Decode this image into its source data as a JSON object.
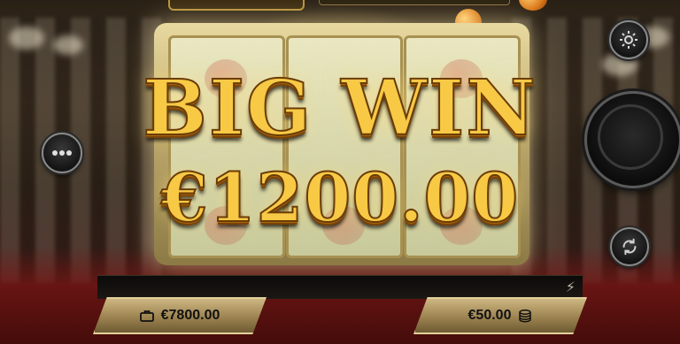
{
  "game": {
    "win_banner": "BIG WIN",
    "win_amount": "€1200.00"
  },
  "balance": {
    "icon": "briefcase-icon",
    "value": "€7800.00"
  },
  "bet": {
    "value": "€50.00",
    "icon": "coin-stack-icon"
  },
  "icons": {
    "settings": "gear-icon",
    "menu": "more-dots-icon",
    "autoplay": "repeat-icon",
    "turbo": "lightning-icon",
    "spin": "spin-icon"
  },
  "colors": {
    "win_text": "#f7c945",
    "panel_gold": "#b89a5e"
  }
}
